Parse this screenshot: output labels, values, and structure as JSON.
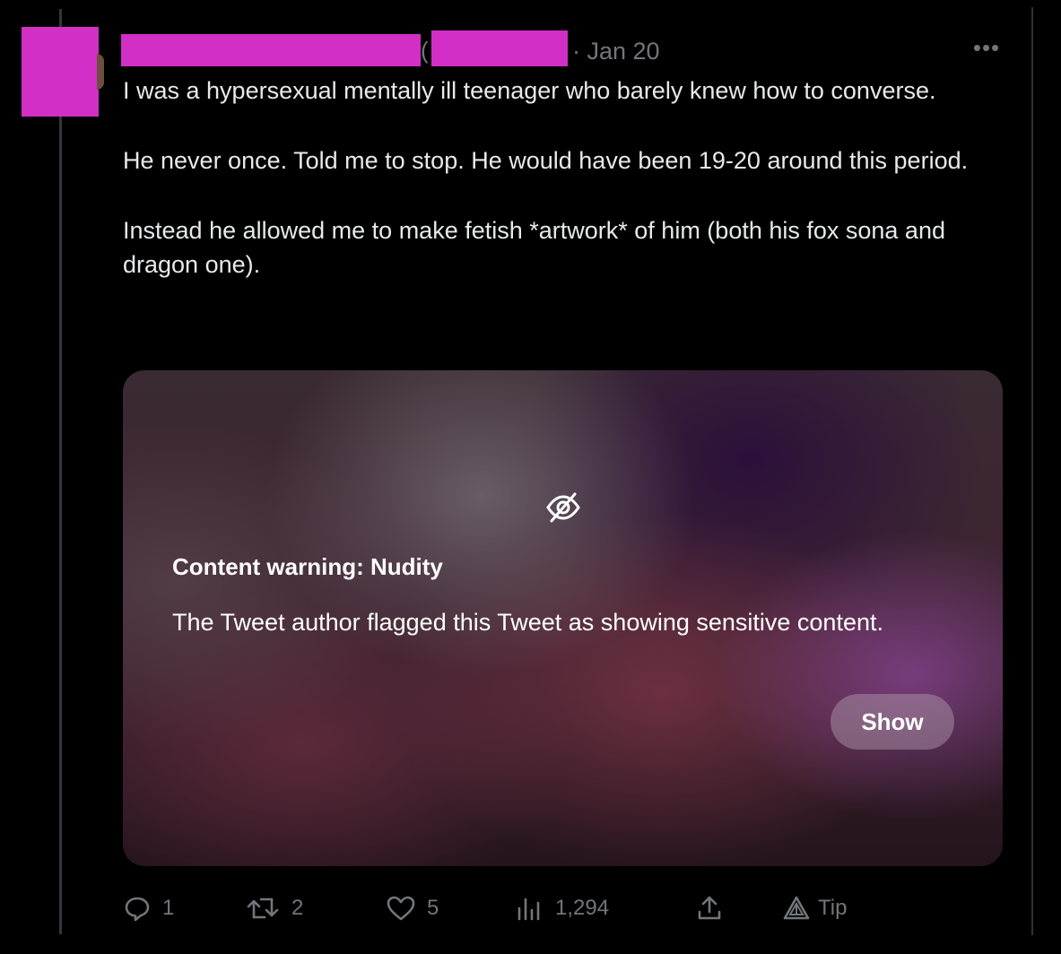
{
  "tweet": {
    "timestamp": "· Jan 20",
    "more_label": "•••",
    "name_separator": "(",
    "paragraphs": [
      "I was a hypersexual mentally ill teenager who barely knew how to converse.",
      "He never once. Told me to stop. He would have been 19-20 around this period.",
      "Instead he allowed me to make fetish *artwork* of him (both his fox sona and dragon one)."
    ]
  },
  "media": {
    "icon": "eye-slash-icon",
    "warning_title": "Content warning: Nudity",
    "warning_description": "The Tweet author flagged this Tweet as showing sensitive content.",
    "show_label": "Show"
  },
  "actions": {
    "reply": {
      "icon": "reply-icon",
      "count": "1"
    },
    "retweet": {
      "icon": "retweet-icon",
      "count": "2"
    },
    "like": {
      "icon": "heart-icon",
      "count": "5"
    },
    "views": {
      "icon": "analytics-icon",
      "count": "1,294"
    },
    "share": {
      "icon": "share-icon"
    },
    "tip": {
      "icon": "tip-icon",
      "label": "Tip"
    }
  },
  "colors": {
    "background": "#000000",
    "text": "#e7e9ea",
    "muted": "#71767b",
    "redaction": "#d12fc5"
  }
}
